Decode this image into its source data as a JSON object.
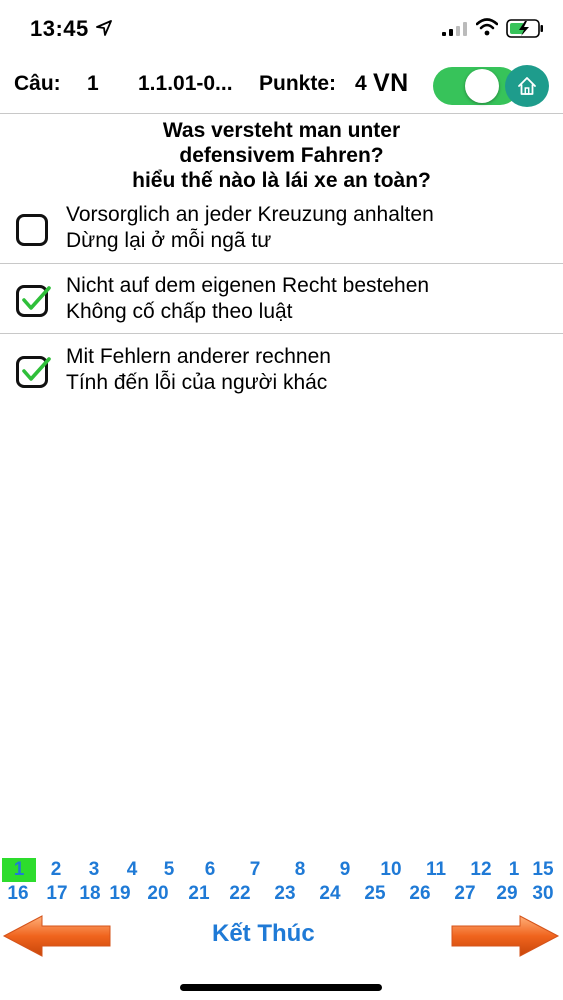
{
  "status_bar": {
    "time": "13:45"
  },
  "header": {
    "cau_label": "Câu:",
    "question_number": "1",
    "question_id": "1.1.01-0...",
    "points_label": "Punkte:",
    "points_value": "4",
    "language_label": "VN",
    "toggle_on": true,
    "accent_color": "#37c35a",
    "home_color": "#1e9c8c"
  },
  "question": {
    "de_line1": "Was versteht man unter",
    "de_line2": "defensivem Fahren?",
    "vi": "hiểu thế nào là lái xe an toàn?"
  },
  "answers": [
    {
      "de": "Vorsorglich an jeder Kreuzung anhalten",
      "vi": "Dừng lại ở mỗi ngã tư",
      "checked": false
    },
    {
      "de": "Nicht auf dem eigenen Recht bestehen",
      "vi": "Không cố chấp theo luật",
      "checked": true
    },
    {
      "de": "Mit Fehlern anderer rechnen",
      "vi": "Tính đến lỗi của người khác",
      "checked": true
    }
  ],
  "pager": {
    "row1": [
      "1",
      "2",
      "3",
      "4",
      "5",
      "6",
      "7",
      "8",
      "9",
      "10",
      "11",
      "12",
      "1",
      "15"
    ],
    "row2": [
      "16",
      "17",
      "18",
      "19",
      "20",
      "21",
      "22",
      "23",
      "24",
      "25",
      "26",
      "27",
      "29",
      "30"
    ],
    "current": "1",
    "current_highlight": "#2ddc2d",
    "link_color": "#1f7ad6"
  },
  "nav": {
    "finish_label": "Kết Thúc",
    "prev_icon": "left-arrow-icon",
    "next_icon": "right-arrow-icon",
    "arrow_color": "#f0641e"
  }
}
